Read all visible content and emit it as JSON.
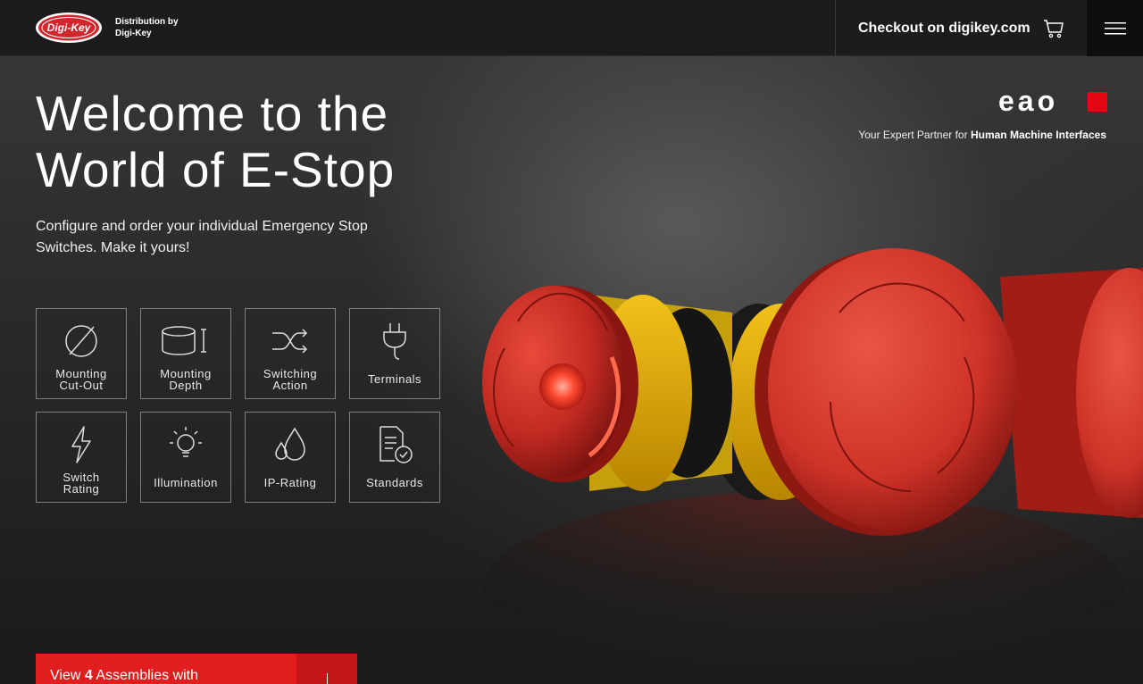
{
  "header": {
    "logo_alt": "Digi-Key Electronics",
    "distribution_line1": "Distribution by",
    "distribution_line2": "Digi-Key",
    "checkout_label": "Checkout on digikey.com"
  },
  "hero": {
    "title_line1": "Welcome to the",
    "title_line2": "World of E-Stop",
    "subtitle": "Configure and order your individual Emergency Stop Switches. Make it yours!"
  },
  "brand": {
    "name": "eao",
    "tagline_prefix": "Your Expert Partner for",
    "tagline_bold": "Human Machine Interfaces",
    "accent_color": "#e30613"
  },
  "filters": [
    {
      "line1": "Mounting",
      "line2": "Cut-Out",
      "icon": "mounting-cutout-icon"
    },
    {
      "line1": "Mounting",
      "line2": "Depth",
      "icon": "mounting-depth-icon"
    },
    {
      "line1": "Switching",
      "line2": "Action",
      "icon": "switching-action-icon"
    },
    {
      "line1": "Terminals",
      "line2": "",
      "icon": "terminals-plug-icon"
    },
    {
      "line1": "Switch",
      "line2": "Rating",
      "icon": "lightning-icon"
    },
    {
      "line1": "Illumination",
      "line2": "",
      "icon": "lightbulb-icon"
    },
    {
      "line1": "IP-Rating",
      "line2": "",
      "icon": "water-drops-icon"
    },
    {
      "line1": "Standards",
      "line2": "",
      "icon": "certificate-document-icon"
    }
  ],
  "cta": {
    "prefix": "View",
    "count": "4",
    "suffix": "Assemblies with"
  },
  "colors": {
    "cta_red": "#e01e1e",
    "topbar": "#1c1c1c"
  }
}
